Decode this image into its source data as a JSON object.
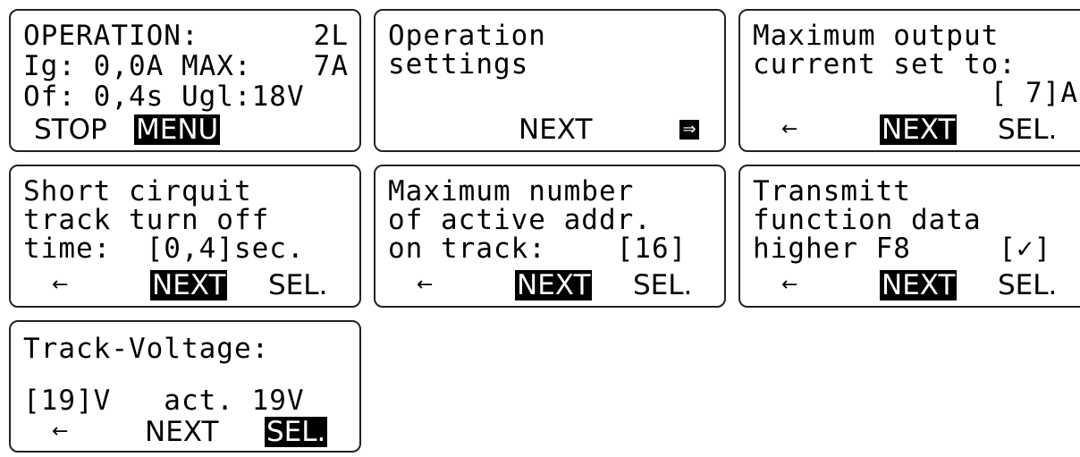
{
  "screens": [
    {
      "lines": [
        [
          "OPERATION:",
          "2L"
        ],
        [
          "Ig: 0,0A MAX:",
          "7A"
        ],
        [
          "Of: 0,4s Ugl:18V",
          ""
        ]
      ],
      "buttons": {
        "left": "STOP",
        "right": "MENU"
      }
    },
    {
      "lines": [
        "Operation",
        "settings"
      ],
      "buttons": {
        "next": "NEXT",
        "arrow": "⇒"
      }
    },
    {
      "lines": [
        "Maximum output",
        "current set to:",
        "[ 7]A"
      ],
      "buttons": {
        "back": "←",
        "next": "NEXT",
        "sel": "SEL."
      }
    },
    {
      "lines": [
        "Short cirquit",
        "track turn off",
        "time:  [0,4]sec."
      ],
      "buttons": {
        "back": "←",
        "next": "NEXT",
        "sel": "SEL."
      }
    },
    {
      "lines": [
        "Maximum number",
        "of active addr.",
        "on track:    [16]"
      ],
      "buttons": {
        "back": "←",
        "next": "NEXT",
        "sel": "SEL."
      }
    },
    {
      "lines": [
        "Transmitt",
        "function data",
        "higher F8     [✓]"
      ],
      "buttons": {
        "back": "←",
        "next": "NEXT",
        "sel": "SEL."
      }
    },
    {
      "lines": [
        "Track-Voltage:",
        "[19]V   act. 19V"
      ],
      "buttons": {
        "back": "←",
        "next": "NEXT",
        "sel": "SEL."
      }
    }
  ]
}
